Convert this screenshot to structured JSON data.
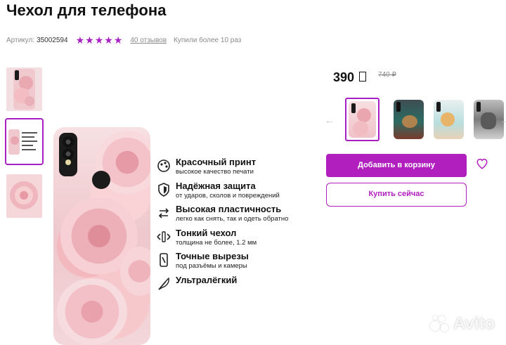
{
  "product": {
    "title": "Чехол для телефона",
    "article_label": "Артикул:",
    "article_value": "35002594",
    "rating": 5,
    "reviews": "40 отзывов",
    "bought": "Купили более 10 раз"
  },
  "pricing": {
    "price": "390",
    "old_price": "740 ₽"
  },
  "features": [
    {
      "title": "Красочный принт",
      "subtitle": "высокое качество печати",
      "icon": "paint-icon"
    },
    {
      "title": "Надёжная защита",
      "subtitle": "от ударов, сколов и повреждений",
      "icon": "shield-icon"
    },
    {
      "title": "Высокая пластичность",
      "subtitle": "легко как снять, так и одеть обратно",
      "icon": "flex-arrows-icon"
    },
    {
      "title": "Тонкий чехол",
      "subtitle": "толщина не более, 1.2 мм",
      "icon": "thin-case-icon"
    },
    {
      "title": "Точные вырезы",
      "subtitle": "под разъёмы и камеры",
      "icon": "cutout-icon"
    },
    {
      "title": "Ультралёгкий",
      "subtitle": "",
      "icon": "feather-icon"
    }
  ],
  "buttons": {
    "add_to_cart": "Добавить в корзину",
    "buy_now": "Купить сейчас"
  },
  "watermark": "Avito",
  "colors": {
    "accent": "#b11fbf",
    "star": "#a81fc4"
  }
}
